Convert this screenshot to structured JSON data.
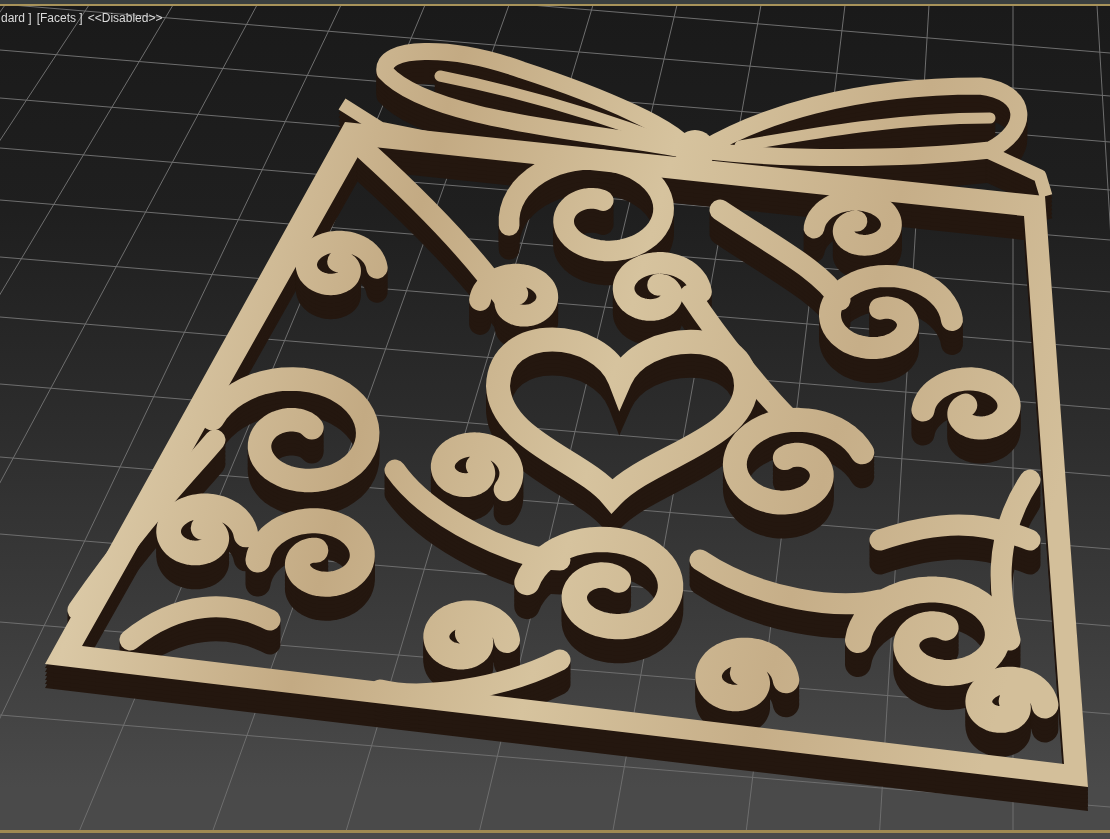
{
  "viewport": {
    "active": true,
    "labels": [
      "dard ]",
      "[Facets ]",
      "<<Disabled>>"
    ]
  }
}
